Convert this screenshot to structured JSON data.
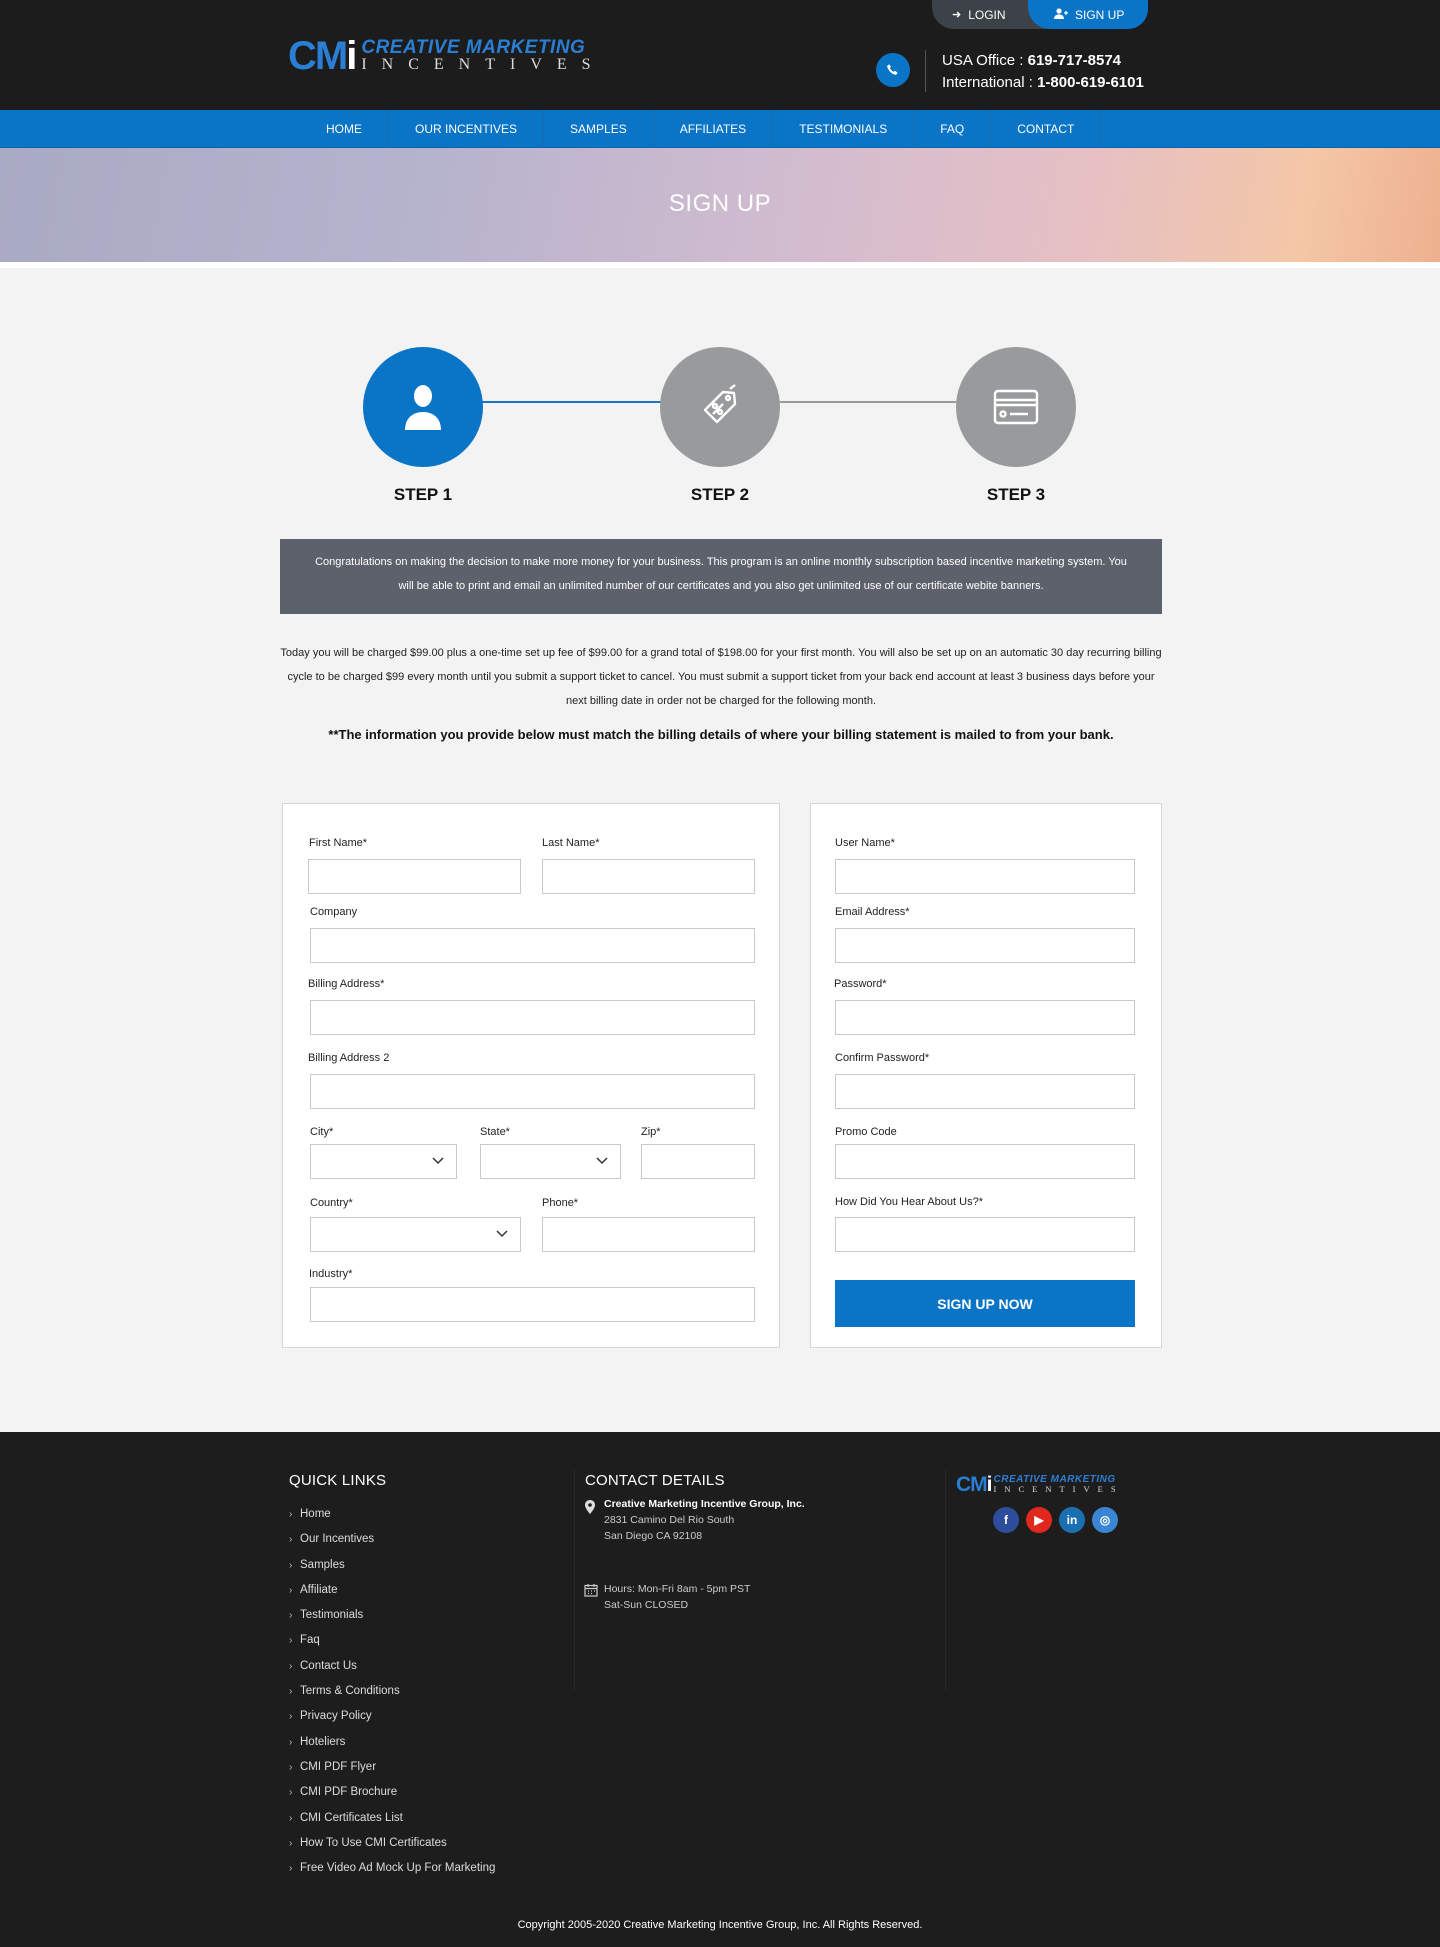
{
  "header": {
    "logo_mark": "CM",
    "logo_mark_i": "i",
    "logo_line1": "CREATIVE MARKETING",
    "logo_line2": "INCENTIVES",
    "login_label": "LOGIN",
    "signup_label": "SIGN UP",
    "usa_office_label": "USA Office :",
    "usa_office_number": "619-717-8574",
    "international_label": "International :",
    "international_number": "1-800-619-6101"
  },
  "nav": {
    "items": [
      "HOME",
      "OUR INCENTIVES",
      "SAMPLES",
      "AFFILIATES",
      "TESTIMONIALS",
      "FAQ",
      "CONTACT"
    ]
  },
  "banner": {
    "title": "SIGN UP"
  },
  "steps": [
    {
      "label": "STEP 1",
      "icon": "user-icon",
      "state": "active"
    },
    {
      "label": "STEP 2",
      "icon": "tag-icon",
      "state": "inactive"
    },
    {
      "label": "STEP 3",
      "icon": "credit-card-icon",
      "state": "inactive"
    }
  ],
  "info": {
    "intro": "Congratulations on making the decision to make more money for your business. This program is an online monthly subscription based incentive marketing system. You will be able to print and email an unlimited number of our certificates and you also get unlimited use of our certificate webite banners.",
    "charge": "Today you will be charged $99.00 plus a one-time set up fee of $99.00 for a grand total of $198.00 for your first month. You will also be set up on an automatic 30 day recurring billing cycle to be charged $99 every month until you submit a support ticket to cancel. You must submit a support ticket from your back end account at least 3 business days before your next billing date in order not be charged for the following month.",
    "billing_note": "**The information you provide below must match the billing details of where your billing statement is mailed to from your bank."
  },
  "form_left": {
    "first_name": "First Name*",
    "last_name": "Last Name*",
    "company": "Company",
    "billing_address": "Billing Address*",
    "billing_address_2": "Billing Address 2",
    "city": "City*",
    "state": "State*",
    "zip": "Zip*",
    "country": "Country*",
    "phone": "Phone*",
    "industry": "Industry*"
  },
  "form_right": {
    "user_name": "User Name*",
    "email": "Email Address*",
    "password": "Password*",
    "confirm_password": "Confirm Password*",
    "promo_code": "Promo Code",
    "how_heard": "How Did You Hear About Us?*",
    "submit": "SIGN UP NOW"
  },
  "footer": {
    "quick_links_title": "QUICK LINKS",
    "quick_links": [
      "Home",
      "Our Incentives",
      "Samples",
      "Affiliate",
      "Testimonials",
      "Faq",
      "Contact Us",
      "Terms & Conditions",
      "Privacy Policy",
      "Hoteliers",
      "CMI PDF Flyer",
      "CMI PDF Brochure",
      "CMI Certificates List",
      "How To Use CMI Certificates",
      "Free Video Ad Mock Up For Marketing"
    ],
    "contact_title": "CONTACT DETAILS",
    "company_name": "Creative Marketing Incentive Group, Inc.",
    "address_line1": "2831 Camino Del Rio South",
    "address_line2": "San Diego CA 92108",
    "hours_line1": "Hours: Mon-Fri 8am - 5pm PST",
    "hours_line2": "Sat-Sun CLOSED",
    "socials": [
      {
        "name": "facebook-icon",
        "glyph": "f",
        "color": "#2d4d9c"
      },
      {
        "name": "youtube-icon",
        "glyph": "▶",
        "color": "#e0281c"
      },
      {
        "name": "linkedin-icon",
        "glyph": "in",
        "color": "#1a6fb0"
      },
      {
        "name": "instagram-icon",
        "glyph": "◎",
        "color": "#3a86d4"
      }
    ],
    "copyright": "Copyright 2005-2020 Creative Marketing Incentive Group, Inc. All Rights Reserved."
  },
  "colors": {
    "brand_blue": "#0a74c7",
    "header_bg": "#1c1c1c",
    "footer_bg": "#1d1d1d",
    "info_box_bg": "#5d616b",
    "step_inactive": "#999a9c"
  }
}
